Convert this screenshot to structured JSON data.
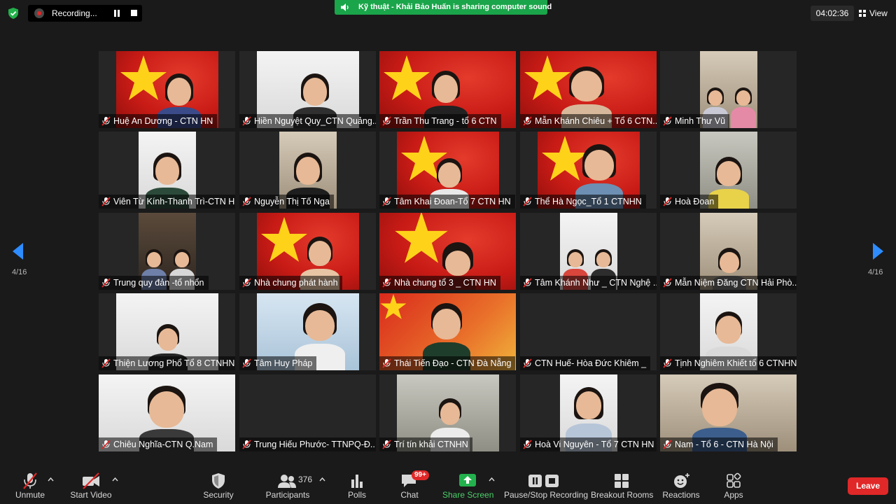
{
  "top_bar": {
    "recording_label": "Recording...",
    "share_banner": "Kỹ thuật - Khải Bảo Huấn is sharing computer sound",
    "timer": "04:02:36",
    "view_label": "View"
  },
  "pagination": {
    "left": "4/16",
    "right": "4/16"
  },
  "participants": [
    "Huệ An Dương - CTN HN",
    "Hiền Nguyệt Quy_CTN Quảng...",
    "Trần Thu Trang - tổ 6 CTN",
    "Mẫn Khánh Chiêu + Tổ 6 CTN...",
    "Minh Thư Vũ",
    "Viên Từ Kính-Thanh Trì-CTN H...",
    "Nguyễn Thị Tố Nga",
    "Tâm Khai Đoan-Tổ 7 CTN HN",
    "Thể Hà Ngọc_Tổ 1 CTNHN",
    "Hoà Đoan",
    "Trung quy đản -tổ nhổn",
    "Nhà chung phát hành",
    "Nhà chung tổ 3 _ CTN HN",
    "Tâm Khánh Như _ CTN Nghệ ...",
    "Mẫn Niệm Đăng CTN Hải Phò...",
    "Thiện Lương Phổ Tổ 8 CTNHN",
    "Tâm Huy Pháp",
    "Thái Tiến Đạo - CTN Đà Nẵng",
    "CTN Huế- Hòa Đức Khiêm _",
    "Tịnh Nghiêm Khiết tổ 6 CTNHN",
    "Chiêu Nghĩa-CTN Q.Nam",
    "Trung Hiếu Phước- TTNPQ-Đ...",
    "Trí tín khải CTNHN",
    "Hoà Vi Nguyên - Tổ 7 CTN HN",
    "Nam - Tổ 6 - CTN Hà Nội"
  ],
  "toolbar": {
    "unmute": "Unmute",
    "start_video": "Start Video",
    "security": "Security",
    "participants": "Participants",
    "participants_count": "376",
    "polls": "Polls",
    "chat": "Chat",
    "chat_badge": "99+",
    "share_screen": "Share Screen",
    "pause_stop_recording": "Pause/Stop Recording",
    "breakout_rooms": "Breakout Rooms",
    "reactions": "Reactions",
    "apps": "Apps",
    "leave": "Leave"
  },
  "colors": {
    "background": "#1a1a1a",
    "share_green": "#1aa54a",
    "leave_red": "#e02828",
    "arrow_blue": "#2d8cff",
    "muted_red": "#e02828"
  }
}
